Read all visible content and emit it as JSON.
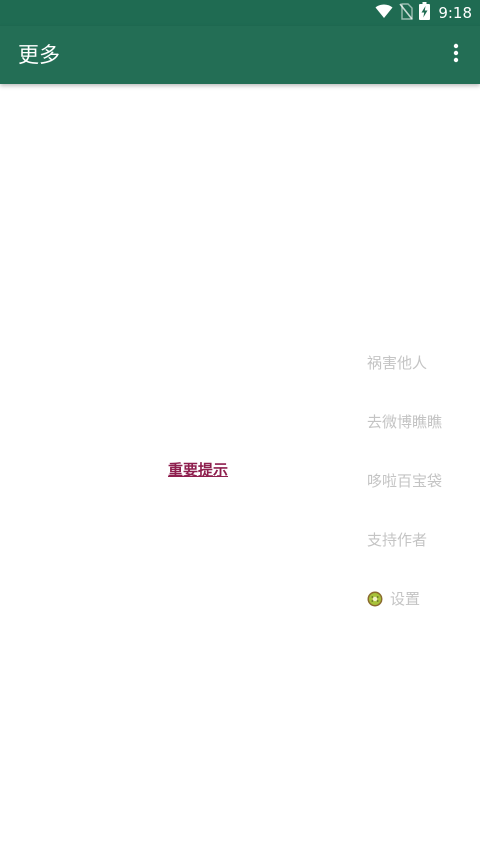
{
  "status_bar": {
    "time": "9:18",
    "icons": [
      "wifi-icon",
      "no-sim-icon",
      "battery-charging-icon"
    ]
  },
  "app_bar": {
    "title": "更多",
    "overflow_icon": "more-vert-icon"
  },
  "notice": {
    "label": "重要提示"
  },
  "menu": {
    "items": [
      {
        "label": "祸害他人"
      },
      {
        "label": "去微博瞧瞧"
      },
      {
        "label": "哆啦百宝袋"
      },
      {
        "label": "支持作者"
      },
      {
        "label": "设置",
        "icon": "kiwi-icon"
      }
    ]
  },
  "colors": {
    "status_bar": "#1f6b52",
    "app_bar": "#236e55",
    "notice_text": "#8e1f4e",
    "menu_text": "#c4c4c4"
  }
}
